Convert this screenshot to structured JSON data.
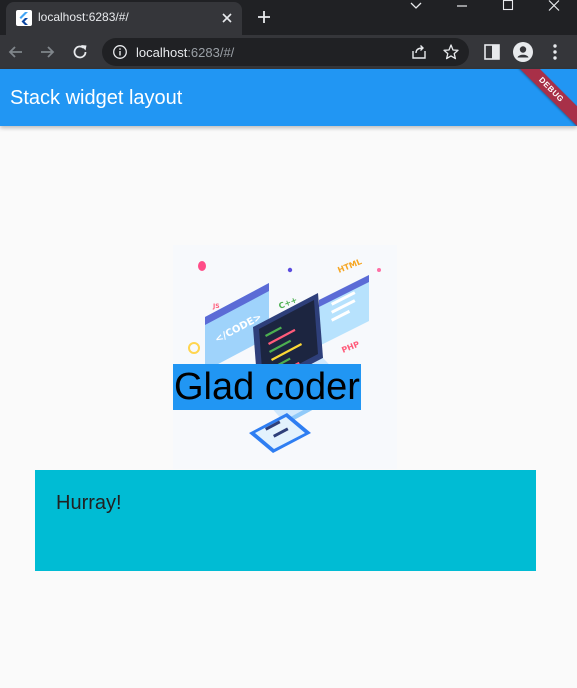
{
  "browser": {
    "tab": {
      "title": "localhost:6283/#/"
    },
    "address": {
      "host": "localhost",
      "rest": ":6283/#/"
    }
  },
  "app": {
    "title": "Stack widget layout",
    "debug_banner": "DEBUG",
    "overlay_text": "Glad coder",
    "card_text": "Hurray!",
    "colors": {
      "primary": "#2196f3",
      "card": "#00bcd4",
      "background": "#fafafa"
    },
    "illustration": {
      "labels": [
        "</CODE>",
        "HTML",
        "C++",
        "PHP",
        "JS"
      ]
    }
  }
}
